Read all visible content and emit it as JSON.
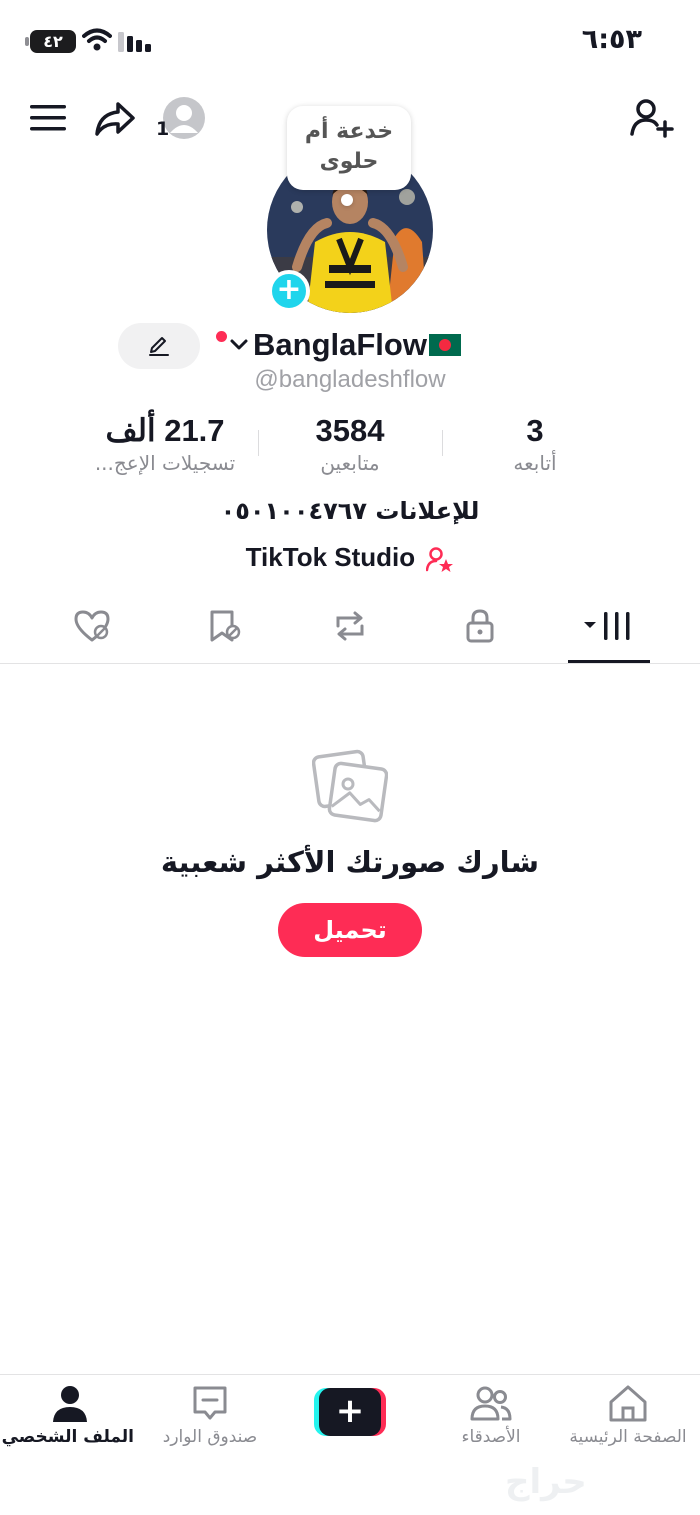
{
  "status_bar": {
    "time": "٦:٥٣",
    "battery": "٤٢"
  },
  "top_bar": {
    "account_count": "1"
  },
  "profile": {
    "bubble_text": "خدعة أم حلوى",
    "display_name": "BanglaFlow",
    "username": "@bangladeshflow",
    "bio": "للإعلانات ٠٥٠١٠٠٤٧٦٧",
    "studio_link": "TikTok Studio"
  },
  "stats": {
    "likes": {
      "value": "21.7 ألف",
      "label": "تسجيلات الإعج..."
    },
    "followers": {
      "value": "3584",
      "label": "متابعين"
    },
    "following": {
      "value": "3",
      "label": "أتابعه"
    }
  },
  "tabs": [
    {
      "name": "videos",
      "icon": "grid-icon",
      "active": true
    },
    {
      "name": "private",
      "icon": "lock-icon"
    },
    {
      "name": "reposts",
      "icon": "repost-icon"
    },
    {
      "name": "favorites",
      "icon": "bookmark-icon"
    },
    {
      "name": "liked",
      "icon": "heart-icon"
    }
  ],
  "empty_state": {
    "title": "شارك صورتك الأكثر شعبية",
    "button": "تحميل"
  },
  "bottom_nav": {
    "profile": "الملف الشخصي",
    "inbox": "صندوق الوارد",
    "friends": "الأصدقاء",
    "home": "الصفحة الرئيسية"
  },
  "watermark": "حراج",
  "colors": {
    "accent": "#fe2c55",
    "cyan": "#25f4ee",
    "text": "#161823",
    "muted": "#8a8b91"
  }
}
